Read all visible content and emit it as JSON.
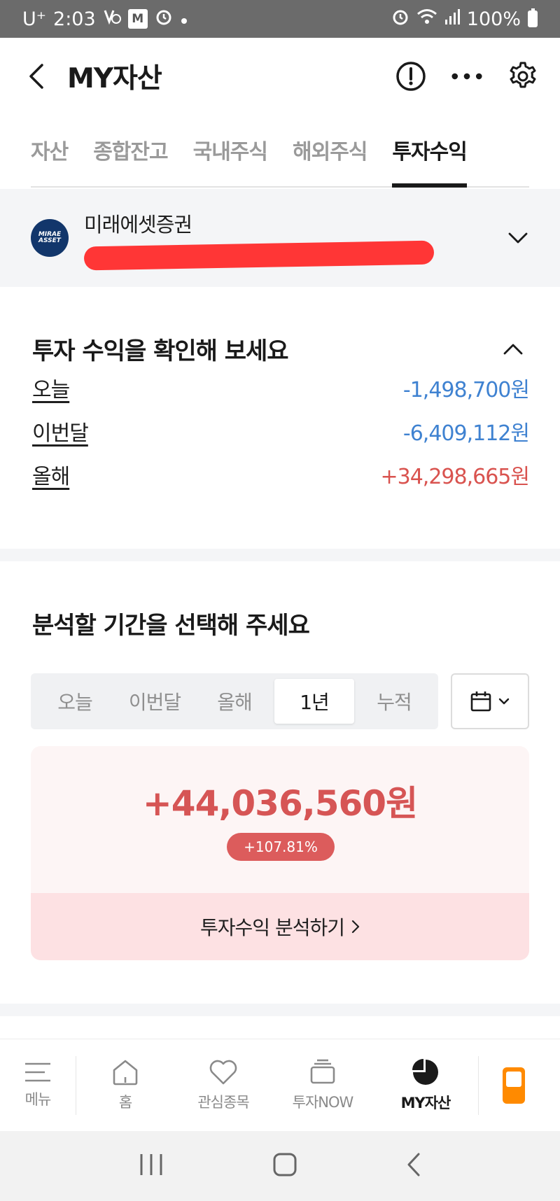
{
  "status_bar": {
    "carrier": "U⁺",
    "time": "2:03",
    "app_badge": "M",
    "battery": "100%"
  },
  "header": {
    "title": "MY자산"
  },
  "tabs": [
    {
      "label": "자산",
      "active": false
    },
    {
      "label": "종합잔고",
      "active": false
    },
    {
      "label": "국내주식",
      "active": false
    },
    {
      "label": "해외주식",
      "active": false
    },
    {
      "label": "투자수익",
      "active": true
    }
  ],
  "account": {
    "broker_name": "미래에셋증권",
    "logo_line1": "MIRAE",
    "logo_line2": "ASSET"
  },
  "summary": {
    "title": "투자 수익을 확인해 보세요",
    "rows": [
      {
        "label": "오늘",
        "value": "-1,498,700원",
        "sign": "neg"
      },
      {
        "label": "이번달",
        "value": "-6,409,112원",
        "sign": "neg"
      },
      {
        "label": "올해",
        "value": "+34,298,665원",
        "sign": "pos"
      }
    ]
  },
  "period": {
    "title": "분석할 기간을 선택해 주세요",
    "options": [
      {
        "label": "오늘",
        "active": false
      },
      {
        "label": "이번달",
        "active": false
      },
      {
        "label": "올해",
        "active": false
      },
      {
        "label": "1년",
        "active": true
      },
      {
        "label": "누적",
        "active": false
      }
    ],
    "result_amount": "+44,036,560원",
    "result_rate": "+107.81%",
    "analyze_label": "투자수익 분석하기"
  },
  "bottom_nav": [
    {
      "label": "메뉴",
      "icon": "menu-icon"
    },
    {
      "label": "홈",
      "icon": "home-icon"
    },
    {
      "label": "관심종목",
      "icon": "heart-icon"
    },
    {
      "label": "투자NOW",
      "icon": "stack-icon"
    },
    {
      "label": "MY자산",
      "icon": "pie-chart-icon",
      "active": true
    },
    {
      "label": "",
      "icon": "phone-app-icon"
    }
  ],
  "colors": {
    "negative": "#3f82d1",
    "positive": "#d9534f",
    "accent_orange": "#ff8a00"
  }
}
